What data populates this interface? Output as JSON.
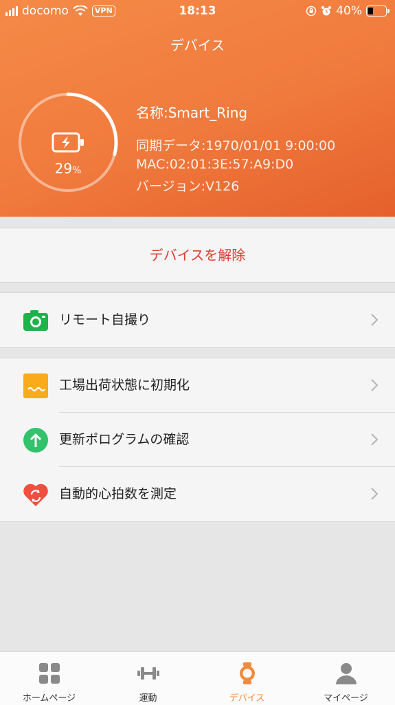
{
  "status_bar": {
    "carrier": "docomo",
    "vpn": "VPN",
    "time": "18:13",
    "battery": "40%"
  },
  "header": {
    "title": "デバイス",
    "battery_percent": "29",
    "battery_unit": "%",
    "battery_level": 0.29
  },
  "device": {
    "name": "名称:Smart_Ring",
    "sync": "同期データ:1970/01/01 9:00:00",
    "mac": "MAC:02:01:3E:57:A9:D0",
    "version": "バージョン:V126"
  },
  "unbind_label": "デバイスを解除",
  "menu": {
    "remote_selfie": "リモート自撮り",
    "factory_reset": "工場出荷状態に初期化",
    "check_update": "更新ポログラムの確認",
    "auto_heart_rate": "自動的心拍数を測定"
  },
  "tabs": [
    {
      "label": "ホームページ",
      "icon": "grid-icon"
    },
    {
      "label": "運動",
      "icon": "dumbbell-icon"
    },
    {
      "label": "デバイス",
      "icon": "watch-icon"
    },
    {
      "label": "マイページ",
      "icon": "person-icon"
    }
  ],
  "colors": {
    "accent": "#f28a3e",
    "header_start": "#f58a47",
    "header_end": "#e5602c",
    "danger": "#e23a2f"
  }
}
